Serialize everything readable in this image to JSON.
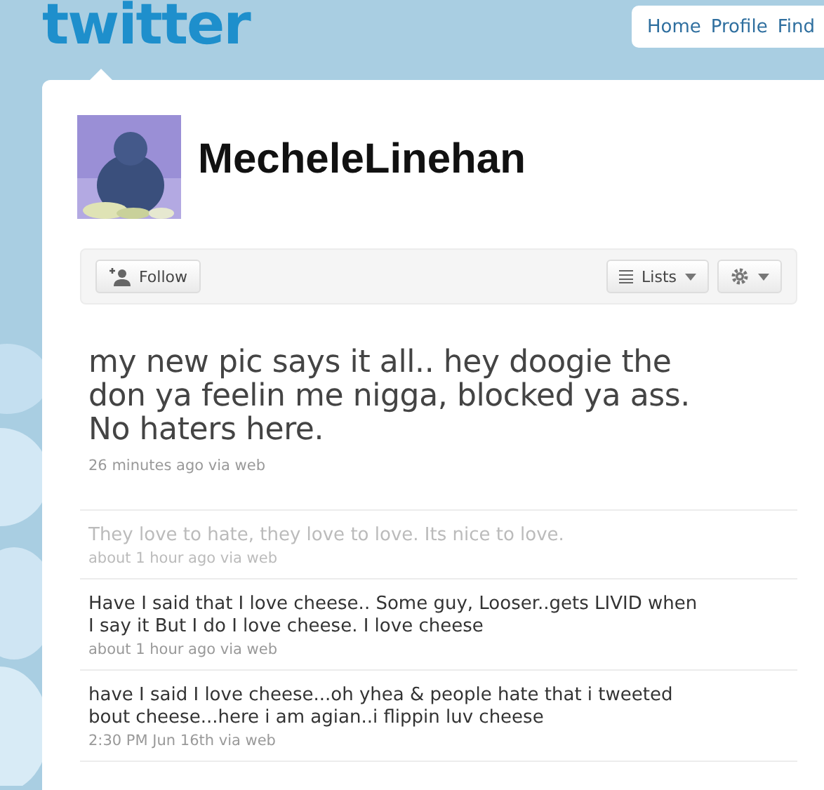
{
  "logo": "twitter",
  "nav": [
    "Home",
    "Profile",
    "Find"
  ],
  "profile": {
    "name": "MecheleLinehan"
  },
  "actions": {
    "follow": "Follow",
    "lists": "Lists"
  },
  "tweets": [
    {
      "kind": "latest",
      "text": "my new pic says it all.. hey doogie the don ya feelin me nigga, blocked ya ass. No haters here.",
      "meta": "26 minutes ago via web"
    },
    {
      "kind": "faded",
      "text": "They love to hate, they love to love. Its nice to love.",
      "meta": "about 1 hour ago via web"
    },
    {
      "kind": "normal",
      "text": "Have I said that I love cheese.. Some guy, Looser..gets LIVID when I say it But I do I love cheese. I love cheese",
      "meta": "about 1 hour ago via web"
    },
    {
      "kind": "normal",
      "text": "have I said I love cheese...oh yhea & people hate that i tweeted bout cheese...here i am agian..i flippin luv cheese",
      "meta": "2:30 PM Jun 16th via web"
    }
  ]
}
